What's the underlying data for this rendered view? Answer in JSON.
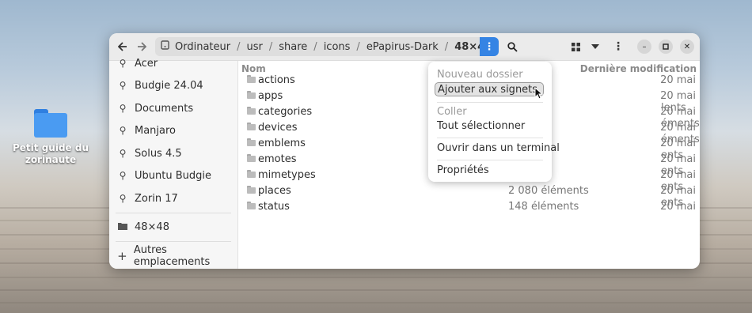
{
  "desktop": {
    "icon_label_line1": "Petit guide du",
    "icon_label_line2": "zorinaute"
  },
  "headerbar": {
    "breadcrumbs": [
      "Ordinateur",
      "usr",
      "share",
      "icons",
      "ePapirus-Dark",
      "48×48"
    ],
    "path_menu_icon": "vertical-dots",
    "back_icon": "arrow-left",
    "forward_icon": "arrow-right",
    "search_icon": "magnifier",
    "view_icon": "grid",
    "sort_icon": "chevron-down",
    "menu_icon": "vertical-dots"
  },
  "sidebar": {
    "items": [
      {
        "label": "Acer",
        "icon": "drive"
      },
      {
        "label": "Budgie 24.04",
        "icon": "drive"
      },
      {
        "label": "Documents",
        "icon": "drive"
      },
      {
        "label": "Manjaro",
        "icon": "drive"
      },
      {
        "label": "Solus 4.5",
        "icon": "drive"
      },
      {
        "label": "Ubuntu Budgie",
        "icon": "drive"
      },
      {
        "label": "Zorin 17",
        "icon": "drive"
      }
    ],
    "bookmark": "48×48",
    "other_locations": "Autres emplacements"
  },
  "list": {
    "headers": {
      "name": "Nom",
      "modified": "Dernière modification"
    },
    "rows": [
      {
        "name": "actions",
        "size": "",
        "date": "20 mai"
      },
      {
        "name": "apps",
        "size": "",
        "date": "20 mai"
      },
      {
        "name": "categories",
        "size": "",
        "date": "20 mai"
      },
      {
        "name": "devices",
        "size": "",
        "date": "20 mai"
      },
      {
        "name": "emblems",
        "size": "",
        "date": "20 mai"
      },
      {
        "name": "emotes",
        "size": "",
        "date": "20 mai"
      },
      {
        "name": "mimetypes",
        "size": "",
        "date": "20 mai"
      },
      {
        "name": "places",
        "size": "2 080 éléments",
        "date": "20 mai"
      },
      {
        "name": "status",
        "size": "148 éléments",
        "date": "20 mai"
      }
    ],
    "partial_sizes": [
      "lents",
      "éments",
      "éments",
      "ents",
      "ents",
      "ents",
      "ents"
    ]
  },
  "popover": {
    "new_folder": "Nouveau dossier",
    "add_bookmark": "Ajouter aux signets",
    "paste": "Coller",
    "select_all": "Tout sélectionner",
    "open_terminal": "Ouvrir dans un terminal",
    "properties": "Propriétés"
  }
}
